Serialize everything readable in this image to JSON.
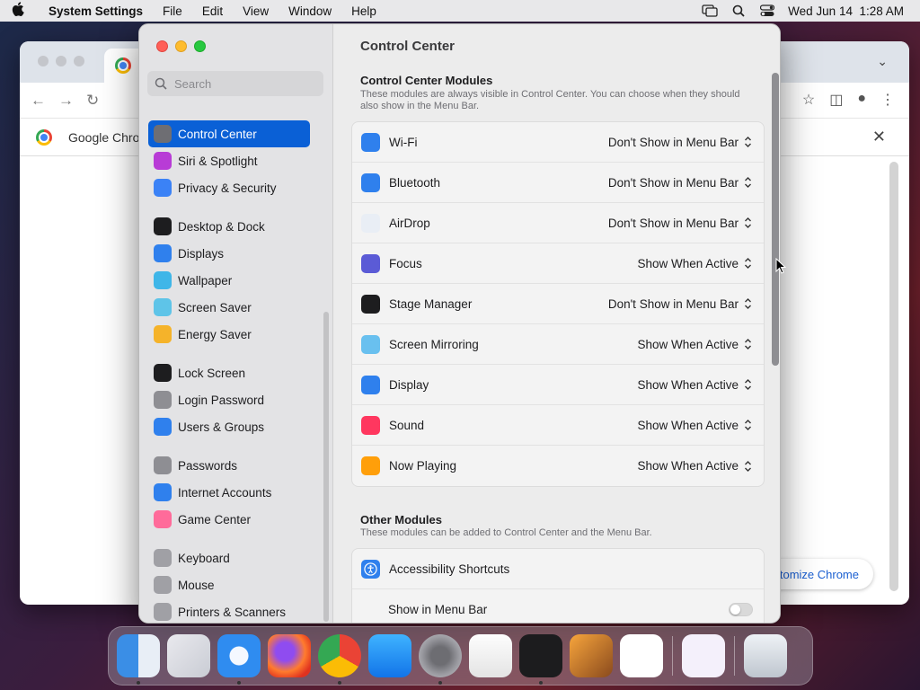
{
  "menubar": {
    "app_name": "System Settings",
    "menus": [
      "File",
      "Edit",
      "View",
      "Window",
      "Help"
    ],
    "datetime": "Wed Jun 14  1:28 AM",
    "icons": [
      "screen-mirroring-icon",
      "search-icon",
      "control-center-icon"
    ]
  },
  "chrome": {
    "bookmark_label": "Google Chrome",
    "customize_label": "Customize Chrome"
  },
  "settings": {
    "search_placeholder": "Search",
    "sidebar": [
      {
        "label": "Control Center",
        "icon": "control-center-icon",
        "color": "#6e6e73",
        "selected": true
      },
      {
        "label": "Siri & Spotlight",
        "icon": "siri-icon",
        "color": "#b83bd6"
      },
      {
        "label": "Privacy & Security",
        "icon": "hand-icon",
        "color": "#3b82f6"
      },
      {
        "label": "Desktop & Dock",
        "icon": "dock-icon",
        "color": "#1d1d1f"
      },
      {
        "label": "Displays",
        "icon": "sun-icon",
        "color": "#2f80ed"
      },
      {
        "label": "Wallpaper",
        "icon": "flower-icon",
        "color": "#3fb6e8"
      },
      {
        "label": "Screen Saver",
        "icon": "screensaver-icon",
        "color": "#5ec4e8"
      },
      {
        "label": "Energy Saver",
        "icon": "bulb-icon",
        "color": "#f5b32a"
      },
      {
        "label": "Lock Screen",
        "icon": "lock-icon",
        "color": "#1d1d1f"
      },
      {
        "label": "Login Password",
        "icon": "lock-icon",
        "color": "#8e8e93"
      },
      {
        "label": "Users & Groups",
        "icon": "users-icon",
        "color": "#2f80ed"
      },
      {
        "label": "Passwords",
        "icon": "key-icon",
        "color": "#8e8e93"
      },
      {
        "label": "Internet Accounts",
        "icon": "at-icon",
        "color": "#2f80ed"
      },
      {
        "label": "Game Center",
        "icon": "gamecenter-icon",
        "color": "#ff6b9a"
      },
      {
        "label": "Keyboard",
        "icon": "keyboard-icon",
        "color": "#a0a0a5"
      },
      {
        "label": "Mouse",
        "icon": "mouse-icon",
        "color": "#a0a0a5"
      },
      {
        "label": "Printers & Scanners",
        "icon": "printer-icon",
        "color": "#a0a0a5"
      }
    ],
    "title": "Control Center",
    "modules_title": "Control Center Modules",
    "modules_desc": "These modules are always visible in Control Center. You can choose when they should also show in the Menu Bar.",
    "modules": [
      {
        "label": "Wi-Fi",
        "value": "Don't Show in Menu Bar",
        "icon": "wifi-icon",
        "color": "#2f80ed"
      },
      {
        "label": "Bluetooth",
        "value": "Don't Show in Menu Bar",
        "icon": "bluetooth-icon",
        "color": "#2f80ed"
      },
      {
        "label": "AirDrop",
        "value": "Don't Show in Menu Bar",
        "icon": "airdrop-icon",
        "color": "#e9eef5"
      },
      {
        "label": "Focus",
        "value": "Show When Active",
        "icon": "moon-icon",
        "color": "#5b5bd6"
      },
      {
        "label": "Stage Manager",
        "value": "Don't Show in Menu Bar",
        "icon": "stage-manager-icon",
        "color": "#1d1d1f"
      },
      {
        "label": "Screen Mirroring",
        "value": "Show When Active",
        "icon": "mirroring-icon",
        "color": "#69c0ef"
      },
      {
        "label": "Display",
        "value": "Show When Active",
        "icon": "sun-icon",
        "color": "#2f80ed"
      },
      {
        "label": "Sound",
        "value": "Show When Active",
        "icon": "speaker-icon",
        "color": "#ff375f"
      },
      {
        "label": "Now Playing",
        "value": "Show When Active",
        "icon": "play-icon",
        "color": "#ff9f0a"
      }
    ],
    "other_title": "Other Modules",
    "other_desc": "These modules can be added to Control Center and the Menu Bar.",
    "other": [
      {
        "label": "Accessibility Shortcuts",
        "icon": "accessibility-icon",
        "color": "#2f80ed"
      },
      {
        "label": "Show in Menu Bar",
        "toggle": false
      }
    ]
  },
  "dock": {
    "apps": [
      "Finder",
      "Launchpad",
      "Safari",
      "Firefox",
      "Google Chrome",
      "App Store",
      "System Settings",
      "TextEdit",
      "Terminal",
      "GarageBand",
      "Visual Studio Code",
      "Visual Studio",
      "Trash"
    ]
  }
}
